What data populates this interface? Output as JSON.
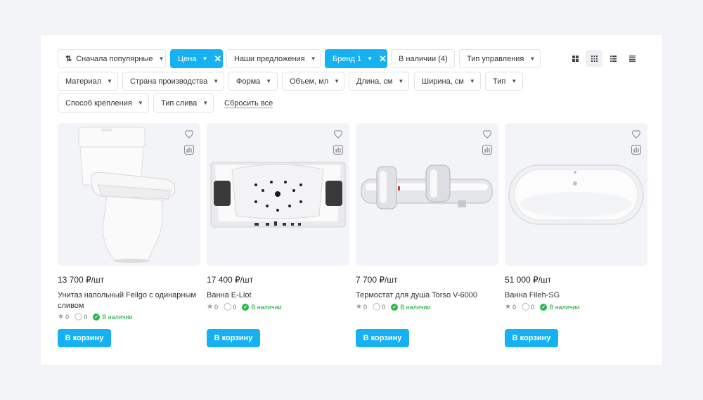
{
  "filters": {
    "sort_label": "Сначала популярные",
    "price_label": "Цена",
    "offers_label": "Наши предложения",
    "brand_label": "Бренд 1",
    "instock_label": "В наличии (4)",
    "control_label": "Тип управления",
    "material_label": "Материал",
    "country_label": "Страна производства",
    "shape_label": "Форма",
    "volume_label": "Объем, мл",
    "length_label": "Длина, см",
    "width_label": "Ширина, см",
    "type_label": "Тип",
    "mount_label": "Способ крепления",
    "drain_label": "Тип слива",
    "reset_label": "Сбросить все"
  },
  "view_modes": [
    "grid-large-icon",
    "grid-small-icon",
    "list-icon",
    "list-compact-icon"
  ],
  "products": [
    {
      "price": "13 700 ₽/шт",
      "name": "Унитаз напольный Feilgo с одинарным сливом",
      "rating": "0",
      "reviews": "0",
      "stock": "В наличии",
      "cart": "В корзину"
    },
    {
      "price": "17 400 ₽/шт",
      "name": "Ванна E-Liot",
      "rating": "0",
      "reviews": "0",
      "stock": "В наличии",
      "cart": "В корзину"
    },
    {
      "price": "7 700 ₽/шт",
      "name": "Термостат для душа Torso V-6000",
      "rating": "0",
      "reviews": "0",
      "stock": "В наличии",
      "cart": "В корзину"
    },
    {
      "price": "51 000 ₽/шт",
      "name": "Ванна Fileh-SG",
      "rating": "0",
      "reviews": "0",
      "stock": "В наличии",
      "cart": "В корзину"
    }
  ],
  "colors": {
    "accent": "#15b1f2",
    "stock": "#2cb34a",
    "background": "#f1f3f7"
  }
}
